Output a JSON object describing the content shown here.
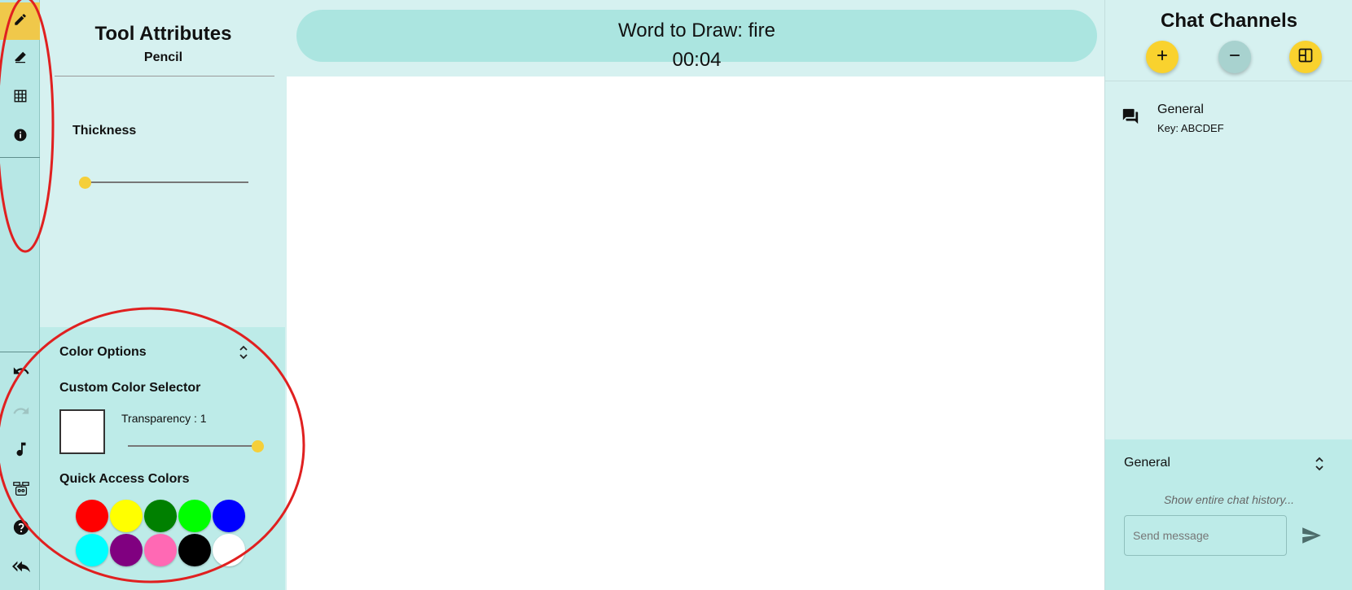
{
  "toolbar": {
    "tools": [
      {
        "name": "pencil",
        "icon": "pencil-icon",
        "active": true
      },
      {
        "name": "eraser",
        "icon": "eraser-icon",
        "active": false
      },
      {
        "name": "grid",
        "icon": "grid-icon",
        "active": false
      },
      {
        "name": "info",
        "icon": "info-icon",
        "active": false
      }
    ],
    "bottom_tools": [
      {
        "name": "undo",
        "icon": "undo-icon"
      },
      {
        "name": "redo",
        "icon": "redo-icon",
        "disabled": true
      },
      {
        "name": "music",
        "icon": "music-note-icon"
      },
      {
        "name": "bot",
        "icon": "robot-icon"
      },
      {
        "name": "help",
        "icon": "help-icon"
      },
      {
        "name": "back",
        "icon": "reply-all-icon"
      }
    ],
    "active_color": "#f0c84a"
  },
  "attributes": {
    "title": "Tool Attributes",
    "tool": "Pencil",
    "thickness_label": "Thickness",
    "thickness_value": 0.02
  },
  "color_options": {
    "title": "Color Options",
    "custom_label": "Custom Color Selector",
    "transparency_label": "Transparency : 1",
    "transparency_value": 1,
    "current_color": "#ffffff",
    "quick_label": "Quick Access Colors",
    "quick_colors": [
      "#ff0000",
      "#ffff00",
      "#008000",
      "#00ff00",
      "#0000ff",
      "#00ffff",
      "#800080",
      "#ff69b4",
      "#000000",
      "#ffffff"
    ]
  },
  "game": {
    "word_label": "Word to Draw: fire",
    "timer": "00:04"
  },
  "chat": {
    "title": "Chat Channels",
    "buttons": [
      {
        "name": "add-channel",
        "icon": "plus-icon",
        "color": "#f9d22e"
      },
      {
        "name": "leave-channel",
        "icon": "minus-icon",
        "color": "#a8d2cf"
      },
      {
        "name": "join-channel",
        "icon": "window-icon",
        "color": "#f9d22e"
      }
    ],
    "channels": [
      {
        "name": "General",
        "key": "Key: ABCDEF",
        "icon": "forum-icon"
      }
    ],
    "active_channel": "General",
    "history_link": "Show entire chat history...",
    "message_placeholder": "Send message",
    "send_icon": "send-icon"
  },
  "annotation_color": "#e02020"
}
